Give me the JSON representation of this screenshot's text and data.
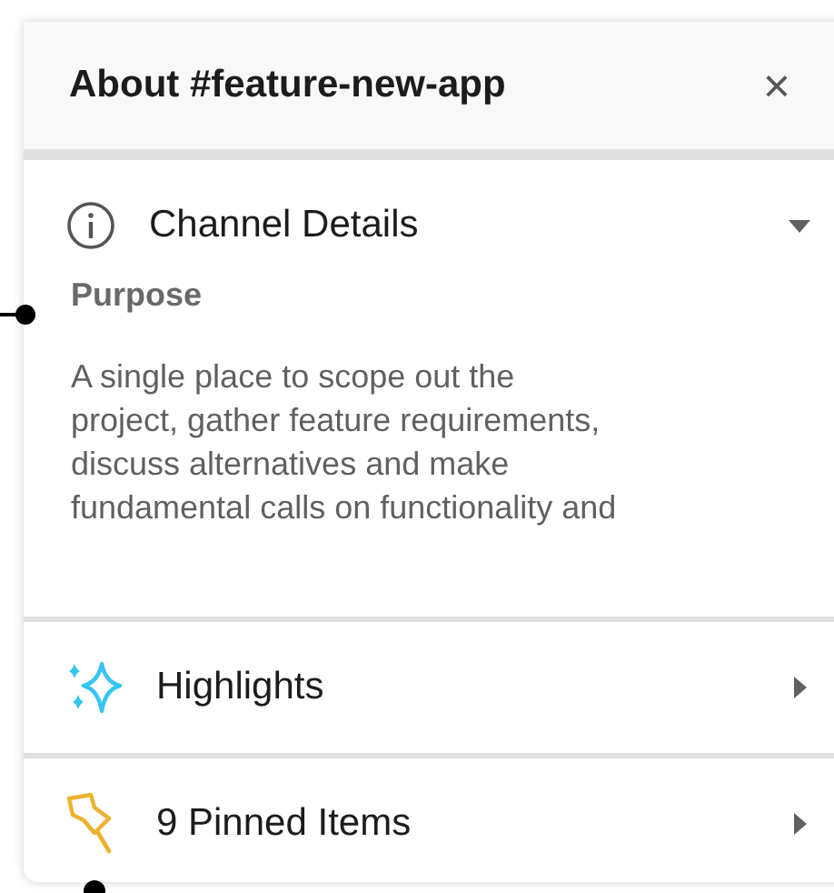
{
  "panel": {
    "title": "About #feature-new-app",
    "close": "×"
  },
  "sections": [
    {
      "kind": "details",
      "label": "Channel Details",
      "expanded": true,
      "purpose_label": "Purpose",
      "purpose_text": "A single place to scope out the\nproject, gather feature requirements,\ndiscuss alternatives and make\nfundamental calls on functionality and"
    },
    {
      "kind": "highlights",
      "label": "Highlights",
      "expanded": false
    },
    {
      "kind": "pinned",
      "label": "9 Pinned Items",
      "expanded": false
    }
  ]
}
